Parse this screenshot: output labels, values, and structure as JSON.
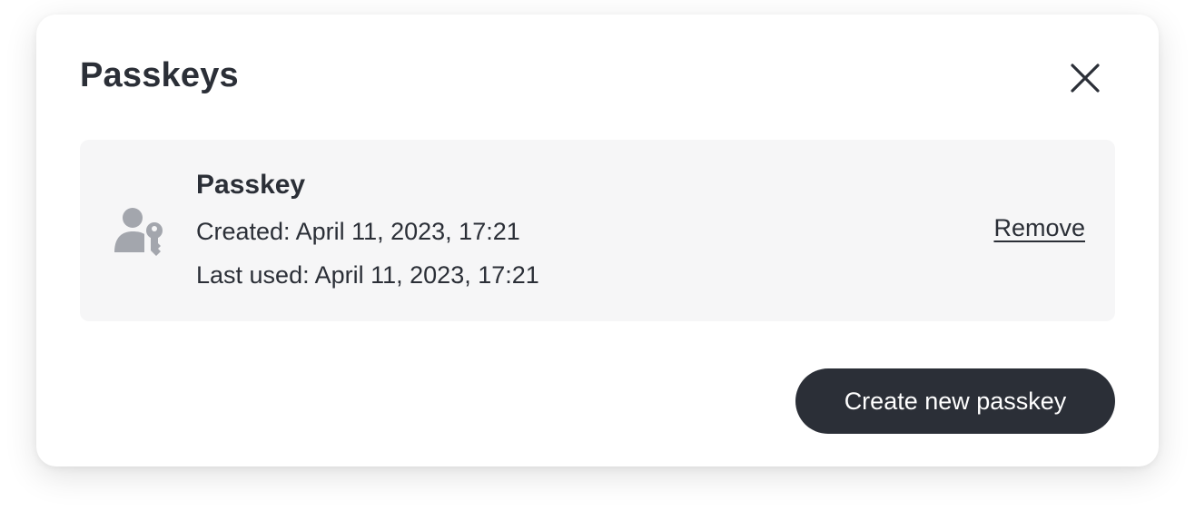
{
  "dialog": {
    "title": "Passkeys",
    "close_icon": "close-icon"
  },
  "passkey": {
    "icon": "user-key-icon",
    "name": "Passkey",
    "created": "Created: April 11, 2023, 17:21",
    "last_used": "Last used: April 11, 2023, 17:21",
    "remove_label": "Remove"
  },
  "actions": {
    "create_label": "Create new passkey"
  },
  "colors": {
    "text": "#2b2f37",
    "card_bg": "#f6f6f7",
    "icon": "#a3a6ad",
    "button_bg": "#2b2f37",
    "button_text": "#ffffff"
  }
}
